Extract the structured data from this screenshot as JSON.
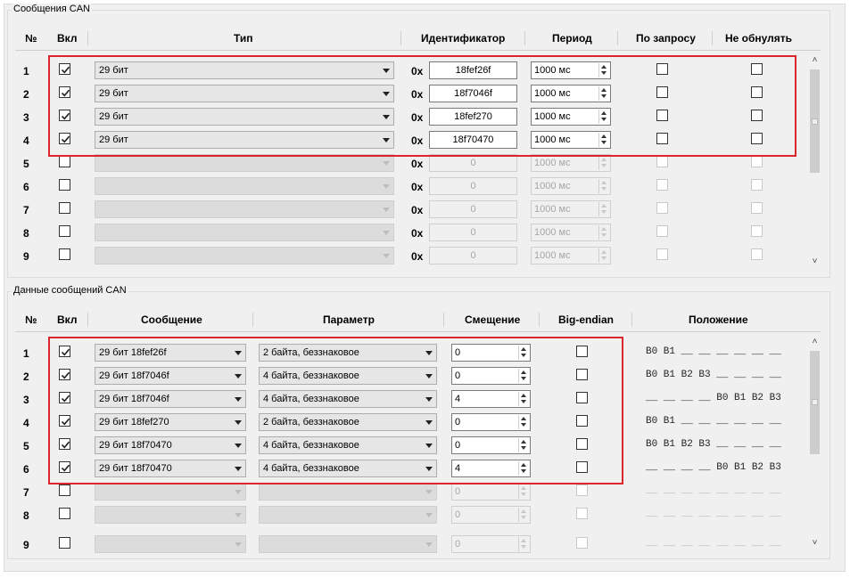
{
  "can_messages": {
    "group_title": "Сообщения CAN",
    "headers": {
      "num": "№",
      "enabled": "Вкл",
      "type": "Тип",
      "identifier": "Идентификатор",
      "period": "Период",
      "on_request": "По запросу",
      "no_reset": "Не обнулять"
    },
    "hex_prefix": "0x",
    "rows": [
      {
        "num": "1",
        "enabled": true,
        "type": "29 бит",
        "id": "18fef26f",
        "period": "1000  мс",
        "on_request": false,
        "no_reset": false,
        "active": true
      },
      {
        "num": "2",
        "enabled": true,
        "type": "29 бит",
        "id": "18f7046f",
        "period": "1000  мс",
        "on_request": false,
        "no_reset": false,
        "active": true
      },
      {
        "num": "3",
        "enabled": true,
        "type": "29 бит",
        "id": "18fef270",
        "period": "1000  мс",
        "on_request": false,
        "no_reset": false,
        "active": true
      },
      {
        "num": "4",
        "enabled": true,
        "type": "29 бит",
        "id": "18f70470",
        "period": "1000  мс",
        "on_request": false,
        "no_reset": false,
        "active": true
      },
      {
        "num": "5",
        "enabled": false,
        "type": "",
        "id": "0",
        "period": "1000  мс",
        "on_request": false,
        "no_reset": false,
        "active": false
      },
      {
        "num": "6",
        "enabled": false,
        "type": "",
        "id": "0",
        "period": "1000  мс",
        "on_request": false,
        "no_reset": false,
        "active": false
      },
      {
        "num": "7",
        "enabled": false,
        "type": "",
        "id": "0",
        "period": "1000  мс",
        "on_request": false,
        "no_reset": false,
        "active": false
      },
      {
        "num": "8",
        "enabled": false,
        "type": "",
        "id": "0",
        "period": "1000  мс",
        "on_request": false,
        "no_reset": false,
        "active": false
      },
      {
        "num": "9",
        "enabled": false,
        "type": "",
        "id": "0",
        "period": "1000  мс",
        "on_request": false,
        "no_reset": false,
        "active": false
      }
    ]
  },
  "can_data": {
    "group_title": "Данные сообщений CAN",
    "headers": {
      "num": "№",
      "enabled": "Вкл",
      "message": "Сообщение",
      "parameter": "Параметр",
      "offset": "Смещение",
      "big_endian": "Big-endian",
      "position": "Положение"
    },
    "rows": [
      {
        "num": "1",
        "enabled": true,
        "message": "29 бит  18fef26f",
        "parameter": "2 байта, беззнаковое",
        "offset": "0",
        "big_endian": false,
        "position": "B0 B1 __ __ __ __ __ __",
        "active": true
      },
      {
        "num": "2",
        "enabled": true,
        "message": "29 бит  18f7046f",
        "parameter": "4 байта, беззнаковое",
        "offset": "0",
        "big_endian": false,
        "position": "B0 B1 B2 B3 __ __ __ __",
        "active": true
      },
      {
        "num": "3",
        "enabled": true,
        "message": "29 бит  18f7046f",
        "parameter": "4 байта, беззнаковое",
        "offset": "4",
        "big_endian": false,
        "position": "__ __ __ __ B0 B1 B2 B3",
        "active": true
      },
      {
        "num": "4",
        "enabled": true,
        "message": "29 бит  18fef270",
        "parameter": "2 байта, беззнаковое",
        "offset": "0",
        "big_endian": false,
        "position": "B0 B1 __ __ __ __ __ __",
        "active": true
      },
      {
        "num": "5",
        "enabled": true,
        "message": "29 бит  18f70470",
        "parameter": "4 байта, беззнаковое",
        "offset": "0",
        "big_endian": false,
        "position": "B0 B1 B2 B3 __ __ __ __",
        "active": true
      },
      {
        "num": "6",
        "enabled": true,
        "message": "29 бит  18f70470",
        "parameter": "4 байта, беззнаковое",
        "offset": "4",
        "big_endian": false,
        "position": "__ __ __ __ B0 B1 B2 B3",
        "active": true
      },
      {
        "num": "7",
        "enabled": false,
        "message": "",
        "parameter": "",
        "offset": "0",
        "big_endian": false,
        "position": "__ __ __ __ __ __ __ __",
        "active": false
      },
      {
        "num": "8",
        "enabled": false,
        "message": "",
        "parameter": "",
        "offset": "0",
        "big_endian": false,
        "position": "__ __ __ __ __ __ __ __",
        "active": false
      },
      {
        "num": "9",
        "enabled": false,
        "message": "",
        "parameter": "",
        "offset": "0",
        "big_endian": false,
        "position": "__ __ __ __ __ __ __ __",
        "active": false
      }
    ]
  },
  "colors": {
    "highlight": "#d9262c",
    "panel": "#f0f0f0"
  }
}
